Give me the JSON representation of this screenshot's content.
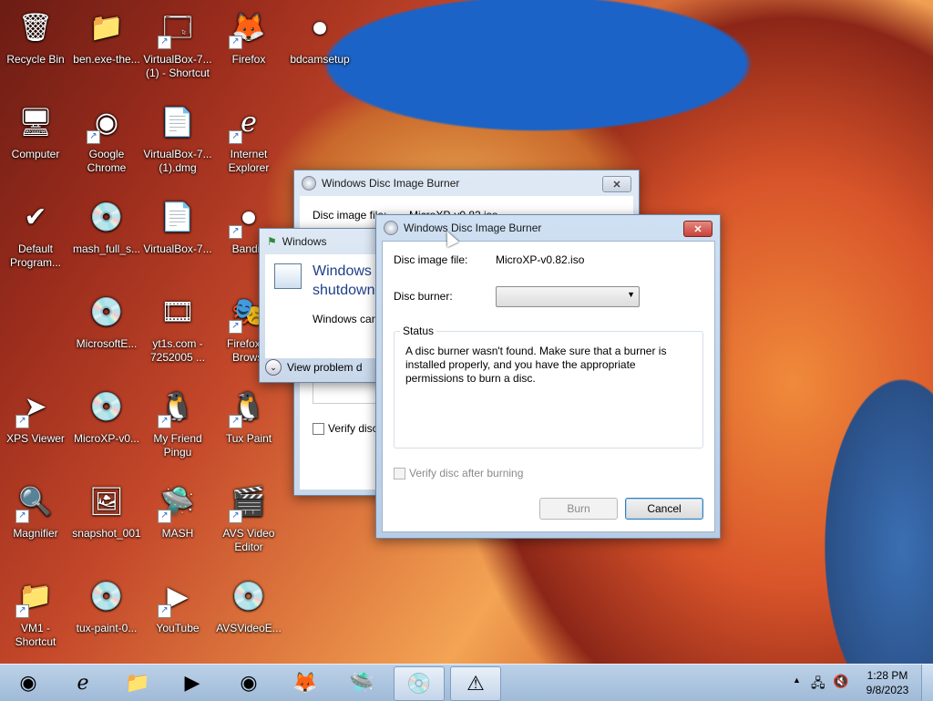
{
  "desktop": {
    "icons": [
      {
        "label": "Recycle Bin",
        "glyph": "🗑",
        "shortcut": false
      },
      {
        "label": "ben.exe-the...",
        "glyph": "📁",
        "shortcut": false
      },
      {
        "label": "VirtualBox-7... (1) - Shortcut",
        "glyph": "🗔",
        "shortcut": true
      },
      {
        "label": "Firefox",
        "glyph": "🦊",
        "shortcut": true
      },
      {
        "label": "bdcamsetup",
        "glyph": "⏺",
        "shortcut": false
      },
      {
        "label": "Computer",
        "glyph": "🖥",
        "shortcut": false
      },
      {
        "label": "Google Chrome",
        "glyph": "◉",
        "shortcut": true
      },
      {
        "label": "VirtualBox-7... (1).dmg",
        "glyph": "📄",
        "shortcut": false
      },
      {
        "label": "Internet Explorer",
        "glyph": "ℯ",
        "shortcut": true
      },
      {
        "label": "Default Program...",
        "glyph": "✔",
        "shortcut": false
      },
      {
        "label": "mash_full_s...",
        "glyph": "💿",
        "shortcut": false
      },
      {
        "label": "VirtualBox-7...",
        "glyph": "📄",
        "shortcut": false
      },
      {
        "label": "Bandic",
        "glyph": "⏺",
        "shortcut": true
      },
      {
        "label": "MicrosoftE...",
        "glyph": "💿",
        "shortcut": false
      },
      {
        "label": "yt1s.com - 7252005 ...",
        "glyph": "🎞",
        "shortcut": false
      },
      {
        "label": "Firefox P Browsi",
        "glyph": "🎭",
        "shortcut": true
      },
      {
        "label": "XPS Viewer",
        "glyph": "➤",
        "shortcut": true
      },
      {
        "label": "MicroXP-v0...",
        "glyph": "💿",
        "shortcut": false
      },
      {
        "label": "My Friend Pingu",
        "glyph": "🐧",
        "shortcut": true
      },
      {
        "label": "Tux Paint",
        "glyph": "🐧",
        "shortcut": true
      },
      {
        "label": "Magnifier",
        "glyph": "🔍",
        "shortcut": true
      },
      {
        "label": "snapshot_001",
        "glyph": "🖼",
        "shortcut": false
      },
      {
        "label": "MASH",
        "glyph": "🛸",
        "shortcut": true
      },
      {
        "label": "AVS Video Editor",
        "glyph": "🎬",
        "shortcut": true
      },
      {
        "label": "VM1 - Shortcut",
        "glyph": "📁",
        "shortcut": true
      },
      {
        "label": "tux-paint-0...",
        "glyph": "💿",
        "shortcut": false
      },
      {
        "label": "YouTube",
        "glyph": "▶",
        "shortcut": true
      },
      {
        "label": "AVSVideoE...",
        "glyph": "💿",
        "shortcut": false
      }
    ]
  },
  "back_burner": {
    "title": "Windows Disc Image Burner",
    "close_glyph": "✕",
    "file_label": "Disc image file:",
    "file_value": "MicroXP-v0.82.iso",
    "verify_label": "Verify disc"
  },
  "shutdown_dialog": {
    "title": "Windows",
    "heading": "Windows shutdown",
    "body": "Windows can",
    "view_problem": "View problem d"
  },
  "burner": {
    "title": "Windows Disc Image Burner",
    "close_glyph": "✕",
    "file_label": "Disc image file:",
    "file_value": "MicroXP-v0.82.iso",
    "burner_label": "Disc burner:",
    "burner_value": "",
    "status_legend": "Status",
    "status_text": "A disc burner wasn't found. Make sure that a burner is installed properly, and you have the appropriate permissions to burn a disc.",
    "verify_label": "Verify disc after burning",
    "verify_checked": false,
    "burn_label": "Burn",
    "cancel_label": "Cancel"
  },
  "taskbar": {
    "items": [
      {
        "name": "start-orb",
        "glyph": "◉"
      },
      {
        "name": "ie",
        "glyph": "ℯ"
      },
      {
        "name": "explorer",
        "glyph": "📁"
      },
      {
        "name": "media-player",
        "glyph": "▶"
      },
      {
        "name": "chrome",
        "glyph": "◉"
      },
      {
        "name": "firefox",
        "glyph": "🦊"
      },
      {
        "name": "mash",
        "glyph": "🛸"
      },
      {
        "name": "disc-burner",
        "glyph": "💿"
      },
      {
        "name": "action-center",
        "glyph": "⚠"
      }
    ],
    "time": "1:28 PM",
    "date": "9/8/2023",
    "tray_up": "▲",
    "tray_network": "🖧",
    "tray_volume": "🔇"
  },
  "colors": {
    "close_red": "#c7413a",
    "accent_blue": "#3c7fb1"
  }
}
